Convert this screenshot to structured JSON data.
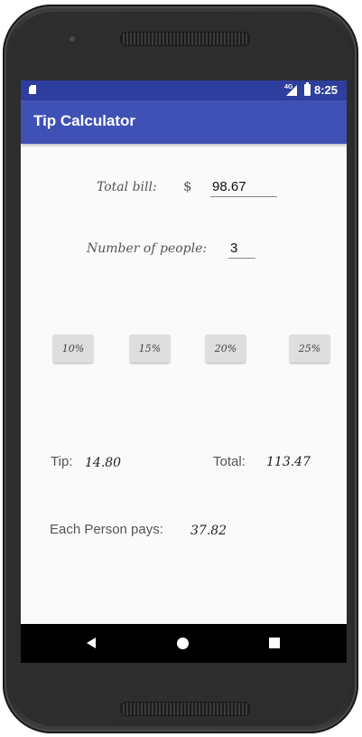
{
  "status_bar": {
    "network": "4G",
    "time": "8:25",
    "icons": [
      "sd-card-icon",
      "signal-icon",
      "battery-icon"
    ]
  },
  "app_bar": {
    "title": "Tip Calculator",
    "color": "#3f51b5"
  },
  "form": {
    "total_bill_label": "Total bill:",
    "currency_symbol": "$",
    "total_bill_value": "98.67",
    "people_label": "Number of people:",
    "people_value": "3"
  },
  "tip_buttons": [
    "10%",
    "15%",
    "20%",
    "25%"
  ],
  "results": {
    "tip_label": "Tip:",
    "tip_value": "14.80",
    "total_label": "Total:",
    "total_value": "113.47",
    "each_label": "Each Person pays:",
    "each_value": "37.82"
  },
  "nav_bar": {
    "icons": [
      "back-icon",
      "home-icon",
      "recents-icon"
    ]
  },
  "colors": {
    "status_bar": "#2e3e9e",
    "app_bar": "#3f51b5",
    "background": "#fafafa",
    "button": "#dedede"
  }
}
